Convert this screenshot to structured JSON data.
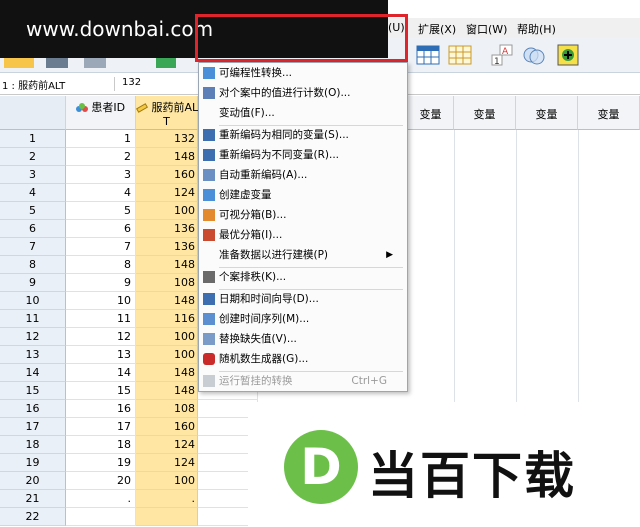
{
  "watermark": "www.downbai.com",
  "menubar": {
    "items": [
      {
        "label": "(U)"
      },
      {
        "label": "扩展(X)"
      },
      {
        "label": "窗口(W)"
      },
      {
        "label": "帮助(H)"
      }
    ]
  },
  "cellref": {
    "name": "1 : 服药前ALT",
    "value": "132"
  },
  "columns": [
    {
      "label": "患者ID"
    },
    {
      "label": "服药前AL"
    },
    {
      "label": "T"
    },
    {
      "label": "变量"
    },
    {
      "label": "变量"
    },
    {
      "label": "变量"
    },
    {
      "label": "变量"
    }
  ],
  "rows": [
    {
      "n": "1",
      "id": "1",
      "alt": "132"
    },
    {
      "n": "2",
      "id": "2",
      "alt": "148"
    },
    {
      "n": "3",
      "id": "3",
      "alt": "160"
    },
    {
      "n": "4",
      "id": "4",
      "alt": "124"
    },
    {
      "n": "5",
      "id": "5",
      "alt": "100"
    },
    {
      "n": "6",
      "id": "6",
      "alt": "136"
    },
    {
      "n": "7",
      "id": "7",
      "alt": "136"
    },
    {
      "n": "8",
      "id": "8",
      "alt": "148"
    },
    {
      "n": "9",
      "id": "9",
      "alt": "108"
    },
    {
      "n": "10",
      "id": "10",
      "alt": "148"
    },
    {
      "n": "11",
      "id": "11",
      "alt": "116"
    },
    {
      "n": "12",
      "id": "12",
      "alt": "100"
    },
    {
      "n": "13",
      "id": "13",
      "alt": "100"
    },
    {
      "n": "14",
      "id": "14",
      "alt": "148"
    },
    {
      "n": "15",
      "id": "15",
      "alt": "148"
    },
    {
      "n": "16",
      "id": "16",
      "alt": "108"
    },
    {
      "n": "17",
      "id": "17",
      "alt": "160"
    },
    {
      "n": "18",
      "id": "18",
      "alt": "124"
    },
    {
      "n": "19",
      "id": "19",
      "alt": "124"
    },
    {
      "n": "20",
      "id": "20",
      "alt": "100"
    },
    {
      "n": "21",
      "id": ".",
      "alt": "."
    },
    {
      "n": "22",
      "id": "",
      "alt": ""
    }
  ],
  "menu": {
    "items": [
      {
        "label": "可编程性转换..."
      },
      {
        "label": "对个案中的值进行计数(O)..."
      },
      {
        "label": "变动值(F)..."
      },
      {
        "label": "重新编码为相同的变量(S)..."
      },
      {
        "label": "重新编码为不同变量(R)..."
      },
      {
        "label": "自动重新编码(A)..."
      },
      {
        "label": "创建虚变量"
      },
      {
        "label": "可视分箱(B)..."
      },
      {
        "label": "最优分箱(I)..."
      },
      {
        "label": "准备数据以进行建模(P)"
      },
      {
        "label": "个案排秩(K)..."
      },
      {
        "label": "日期和时间向导(D)..."
      },
      {
        "label": "创建时间序列(M)..."
      },
      {
        "label": "替换缺失值(V)..."
      },
      {
        "label": "随机数生成器(G)..."
      },
      {
        "label": "运行暂挂的转换"
      }
    ],
    "shortcut": "Ctrl+G"
  },
  "logo_text": "当百下载",
  "logo_letter": "D",
  "colors": {
    "highlight": "#e0242c",
    "alt_column": "#ffe7a3",
    "logo_green": "#6cc04a"
  }
}
